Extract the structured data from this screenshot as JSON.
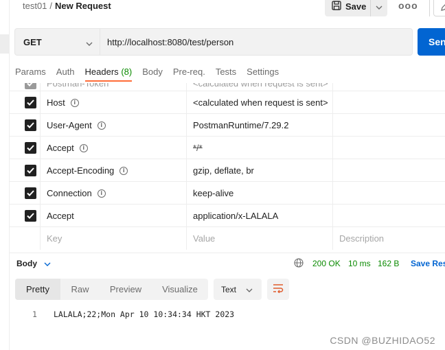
{
  "breadcrumb": {
    "parent": "test01",
    "separator": "/",
    "current": "New Request"
  },
  "toolbar": {
    "save_label": "Save",
    "more_label": "ooo"
  },
  "request": {
    "method": "GET",
    "url": "http://localhost:8080/test/person",
    "send_label": "Sen"
  },
  "tabs": [
    {
      "label": "Params"
    },
    {
      "label": "Auth"
    },
    {
      "label": "Headers",
      "count": "(8)",
      "active": true
    },
    {
      "label": "Body"
    },
    {
      "label": "Pre-req."
    },
    {
      "label": "Tests"
    },
    {
      "label": "Settings"
    }
  ],
  "headers": {
    "partial_row": {
      "key": "Postman-Token",
      "value": "<calculated when request is sent>"
    },
    "rows": [
      {
        "key": "Host",
        "value": "<calculated when request is sent>",
        "checked": true,
        "info": true
      },
      {
        "key": "User-Agent",
        "value": "PostmanRuntime/7.29.2",
        "checked": true,
        "info": true
      },
      {
        "key": "Accept",
        "value": "*/*",
        "checked": true,
        "info": true,
        "struck": true
      },
      {
        "key": "Accept-Encoding",
        "value": "gzip, deflate, br",
        "checked": true,
        "info": true
      },
      {
        "key": "Connection",
        "value": "keep-alive",
        "checked": true,
        "info": true
      },
      {
        "key": "Accept",
        "value": "application/x-LALALA",
        "checked": true,
        "info": false
      }
    ],
    "placeholders": {
      "key": "Key",
      "value": "Value",
      "description": "Description"
    }
  },
  "response": {
    "section_label": "Body",
    "status": "200 OK",
    "time": "10 ms",
    "size": "162 B",
    "save_label": "Save Res",
    "view_tabs": [
      {
        "label": "Pretty",
        "active": true
      },
      {
        "label": "Raw"
      },
      {
        "label": "Preview"
      },
      {
        "label": "Visualize"
      }
    ],
    "format": "Text",
    "lines": [
      {
        "number": "1",
        "text": "LALALA;22;Mon Apr 10 10:34:34 HKT 2023"
      }
    ]
  },
  "watermark": "CSDN @BUZHIDAO52",
  "colors": {
    "accent": "#ff6c37",
    "send": "#0265d2",
    "status_ok": "#0a8a00",
    "checkbox": "#212121"
  },
  "icons": [
    "save-icon",
    "chevron-down-icon",
    "more-icon",
    "edit-icon",
    "info-icon",
    "check-icon",
    "globe-icon",
    "wrap-lines-icon"
  ]
}
